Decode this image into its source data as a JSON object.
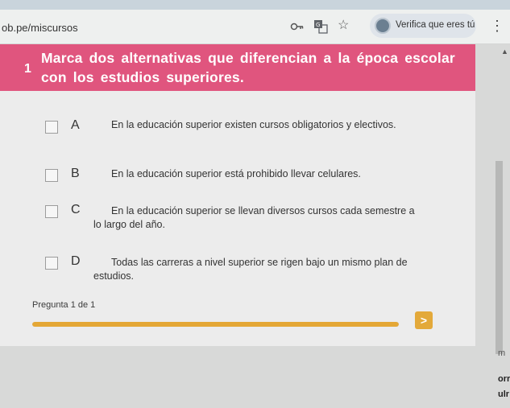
{
  "browser": {
    "url": "ob.pe/miscursos",
    "profile_label": "Verifica que eres tú",
    "icons": [
      "key-icon",
      "translate-icon",
      "star-icon",
      "menu-icon"
    ]
  },
  "question": {
    "number": "1",
    "text": "Marca dos alternativas que diferencian a la época escolar con los estudios superiores."
  },
  "options": [
    {
      "letter": "A",
      "text": "En la educación superior existen cursos obligatorios y electivos."
    },
    {
      "letter": "B",
      "text": "En la educación superior está prohibido llevar celulares."
    },
    {
      "letter": "C",
      "text": "En la educación superior se llevan diversos cursos cada semestre a lo largo del año."
    },
    {
      "letter": "D",
      "text": "Todas las carreras a nivel superior se rigen bajo un mismo plan de estudios."
    }
  ],
  "progress": {
    "label": "Pregunta 1 de 1",
    "fraction": 1.0,
    "next_label": ">"
  },
  "side_fragments": [
    "m",
    "orr",
    "ulr"
  ],
  "colors": {
    "banner": "#e0557e",
    "accent": "#e4a736"
  }
}
